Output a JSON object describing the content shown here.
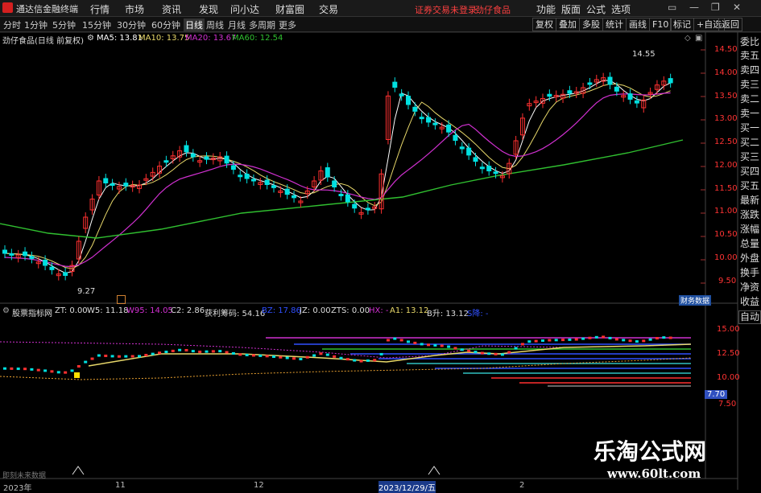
{
  "app_title": "通达信金融终端",
  "menu": [
    "行情",
    "市场",
    "资讯",
    "发现",
    "问小达",
    "财富圈",
    "交易"
  ],
  "warning": "证券交易未登录",
  "stock_name_top": "劲仔食品",
  "right_menu": [
    "功能",
    "版面",
    "公式",
    "选项"
  ],
  "window_controls": [
    "▭",
    "—",
    "❐",
    "✕"
  ],
  "periods": [
    "分时",
    "1分钟",
    "5分钟",
    "15分钟",
    "30分钟",
    "60分钟",
    "日线",
    "周线",
    "月线",
    "多周期",
    "更多"
  ],
  "active_period": "日线",
  "tools": [
    "复权",
    "叠加",
    "多股",
    "统计",
    "画线",
    "F10",
    "标记",
    "+自选",
    "返回"
  ],
  "main_legend": {
    "title": "劲仔食品(日线 前复权)",
    "ma5": "MA5: 13.81",
    "ma10": "MA10: 13.75",
    "ma20": "MA20: 13.67",
    "ma60": "MA60: 12.54"
  },
  "colors": {
    "ma5": "#ffffff",
    "ma10": "#e8d86a",
    "ma20": "#d030d0",
    "ma60": "#30c030",
    "up": "#ff3030",
    "down": "#00e0e0"
  },
  "price_axis": [
    "14.50",
    "14.00",
    "13.50",
    "13.00",
    "12.50",
    "12.00",
    "11.50",
    "11.00",
    "10.50",
    "10.00",
    "9.50"
  ],
  "high_label": "14.55",
  "low_label": "9.27",
  "finance_tag": "财务数据",
  "order_panel": [
    "委比",
    "卖五",
    "卖四",
    "卖三",
    "卖二",
    "卖一",
    "买一",
    "买二",
    "买三",
    "买四",
    "买五",
    "最新",
    "涨跌",
    "涨幅",
    "总量",
    "外盘",
    "换手",
    "净资",
    "收益"
  ],
  "indicator_legend": {
    "name": "股票指标网",
    "zt": "ZT: 0.00",
    "w5": "W5: 11.18",
    "w95": "W95: 14.05",
    "c2": "C2: 2.86",
    "profit": "获利筹码: 54.16",
    "bz": "BZ: 17.86",
    "jz": "JZ: 0.00",
    "zts": "ZTS: 0.00",
    "hx": "HX: -",
    "a1": "A1: 13.12",
    "b": "B升: 13.12",
    "sell": "S降: -"
  },
  "auto_label": "自动",
  "ind_axis": [
    "15.00",
    "12.50",
    "10.00",
    "7.50"
  ],
  "ind_current": "7.70",
  "date_axis": [
    "2023年",
    "11",
    "12",
    "2023/12/29/五",
    "2"
  ],
  "bottom_note": "即刻未来数据",
  "watermark_cn": "乐淘公式网",
  "watermark_url": "www.60lt.com"
}
